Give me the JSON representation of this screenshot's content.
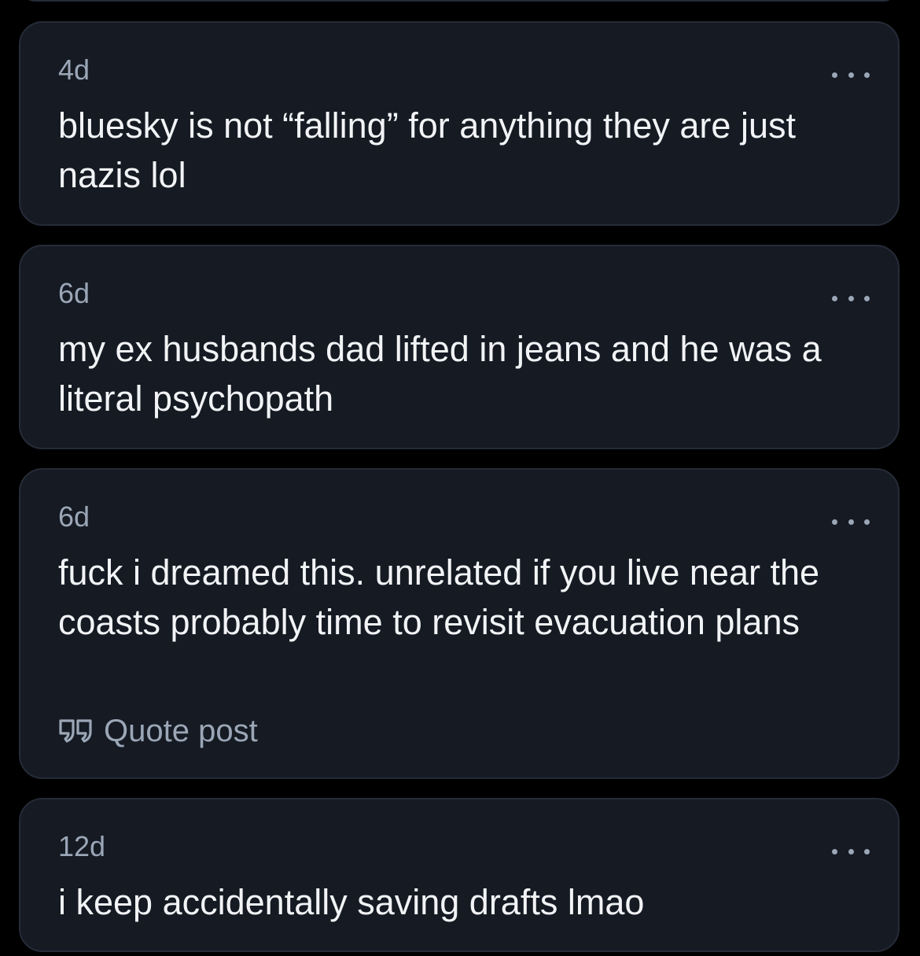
{
  "posts": [
    {
      "time": "4d",
      "text": "bluesky is not “falling” for anything they are just nazis lol",
      "more_icon": "ellipsis-icon"
    },
    {
      "time": "6d",
      "text": "my ex husbands dad lifted in jeans and he was a literal psychopath",
      "more_icon": "ellipsis-icon"
    },
    {
      "time": "6d",
      "text": "fuck i dreamed this. unrelated if you live near the coasts probably time to revisit evacuation plans",
      "more_icon": "ellipsis-icon",
      "quote_label": "Quote post",
      "quote_icon": "quote-icon"
    },
    {
      "time": "12d",
      "text": "i keep accidentally saving drafts lmao",
      "more_icon": "ellipsis-icon"
    }
  ],
  "colors": {
    "background": "#000000",
    "card": "#151a23",
    "card_border": "#252b37",
    "text_primary": "#f1f3f5",
    "text_secondary": "#9ba6b6"
  }
}
